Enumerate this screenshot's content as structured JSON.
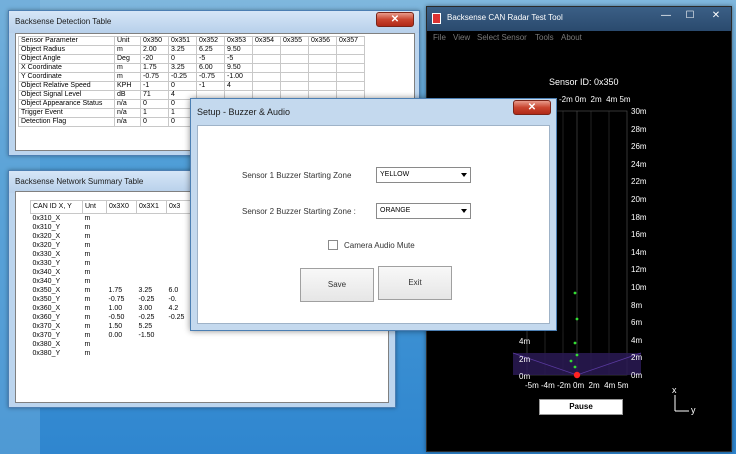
{
  "detection": {
    "title": "Backsense Detection Table",
    "close": "✕",
    "headers": [
      "Sensor Parameter",
      "Unit",
      "0x350",
      "0x351",
      "0x352",
      "0x353",
      "0x354",
      "0x355",
      "0x356",
      "0x357"
    ],
    "rows": [
      [
        "Object Radius",
        "m",
        "2.00",
        "3.25",
        "6.25",
        "9.50",
        "",
        "",
        "",
        ""
      ],
      [
        "Object Angle",
        "Deg",
        "-20",
        "0",
        "-5",
        "-5",
        "",
        "",
        "",
        ""
      ],
      [
        "X Coordinate",
        "m",
        "1.75",
        "3.25",
        "6.00",
        "9.50",
        "",
        "",
        "",
        ""
      ],
      [
        "Y Coordinate",
        "m",
        "-0.75",
        "-0.25",
        "-0.75",
        "-1.00",
        "",
        "",
        "",
        ""
      ],
      [
        "Object Relative Speed",
        "KPH",
        "-1",
        "0",
        "-1",
        "4",
        "",
        "",
        "",
        ""
      ],
      [
        "Object Signal Level",
        "dB",
        "71",
        "4",
        "",
        "",
        "",
        "",
        "",
        ""
      ],
      [
        "Object Appearance Status",
        "n/a",
        "0",
        "0",
        "",
        "",
        "",
        "",
        "",
        ""
      ],
      [
        "Trigger Event",
        "n/a",
        "1",
        "1",
        "",
        "",
        "",
        "",
        "",
        ""
      ],
      [
        "Detection Flag",
        "n/a",
        "0",
        "0",
        "",
        "",
        "",
        "",
        "",
        ""
      ]
    ]
  },
  "network": {
    "title": "Backsense Network Summary Table",
    "headers": [
      "CAN ID X, Y",
      "Unt",
      "0x3X0",
      "0x3X1",
      "0x3"
    ],
    "rows": [
      [
        "0x310_X",
        "m",
        "",
        "",
        ""
      ],
      [
        "0x310_Y",
        "m",
        "",
        "",
        ""
      ],
      [
        "0x320_X",
        "m",
        "",
        "",
        ""
      ],
      [
        "0x320_Y",
        "m",
        "",
        "",
        ""
      ],
      [
        "0x330_X",
        "m",
        "",
        "",
        ""
      ],
      [
        "0x330_Y",
        "m",
        "",
        "",
        ""
      ],
      [
        "0x340_X",
        "m",
        "",
        "",
        ""
      ],
      [
        "0x340_Y",
        "m",
        "",
        "",
        ""
      ],
      [
        "0x350_X",
        "m",
        "1.75",
        "3.25",
        "6.0"
      ],
      [
        "0x350_Y",
        "m",
        "-0.75",
        "-0.25",
        "-0."
      ],
      [
        "0x360_X",
        "m",
        "1.00",
        "3.00",
        "4.2"
      ],
      [
        "0x360_Y",
        "m",
        "-0.50",
        "-0.25",
        "-0.25"
      ],
      [
        "0x370_X",
        "m",
        "1.50",
        "5.25",
        ""
      ],
      [
        "0x370_Y",
        "m",
        "0.00",
        "-1.50",
        ""
      ],
      [
        "0x380_X",
        "m",
        "",
        "",
        ""
      ],
      [
        "0x380_Y",
        "m",
        "",
        "",
        ""
      ]
    ]
  },
  "radar": {
    "title": "Backsense CAN Radar Test Tool",
    "menu": [
      "File",
      "View",
      "Select Sensor",
      "Tools",
      "About"
    ],
    "minimize": "—",
    "maximize": "☐",
    "close": "✕",
    "sensor_id": "Sensor ID: 0x350",
    "top_axis": "-2m 0m  2m  4m 5m",
    "bottom_axis": "-5m -4m -2m 0m  2m  4m 5m",
    "right_ticks": [
      "30m",
      "28m",
      "26m",
      "24m",
      "22m",
      "20m",
      "18m",
      "16m",
      "14m",
      "12m",
      "10m",
      "8m",
      "6m",
      "4m",
      "2m",
      "0m"
    ],
    "left_ticks": [
      "4m",
      "2m",
      "0m"
    ],
    "axis_x_label": "x",
    "axis_y_label": "y",
    "pause_label": "Pause",
    "dot_color": "#33dd33",
    "origin_color": "#ff2222"
  },
  "dialog": {
    "title": "Setup - Buzzer & Audio",
    "close": "✕",
    "sensor1_label": "Sensor 1 Buzzer Starting Zone",
    "sensor1_value": "YELLOW",
    "sensor2_label": "Sensor 2 Buzzer Starting Zone :",
    "sensor2_value": "ORANGE",
    "mute_label": "Camera Audio Mute",
    "save_label": "Save",
    "exit_label": "Exit"
  }
}
